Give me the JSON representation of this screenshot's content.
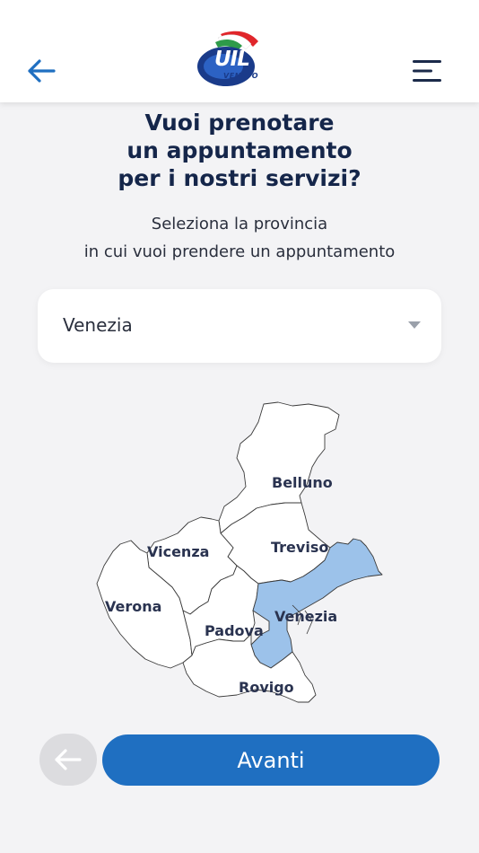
{
  "header": {
    "logo_title": "UIL",
    "logo_subtitle": "VENETO"
  },
  "page": {
    "title_lines": [
      "Vuoi prenotare",
      "un appuntamento",
      "per i nostri servizi?"
    ],
    "subtitle_lines": [
      "Seleziona la provincia",
      "in cui vuoi prendere un appuntamento"
    ]
  },
  "province_select": {
    "selected_value": "Venezia"
  },
  "map": {
    "provinces": [
      {
        "name": "Belluno",
        "selected": false
      },
      {
        "name": "Vicenza",
        "selected": false
      },
      {
        "name": "Treviso",
        "selected": false
      },
      {
        "name": "Verona",
        "selected": false
      },
      {
        "name": "Venezia",
        "selected": true
      },
      {
        "name": "Padova",
        "selected": false
      },
      {
        "name": "Rovigo",
        "selected": false
      }
    ],
    "colors": {
      "selected_fill": "#9cc2ea",
      "default_fill": "#ffffff",
      "border": "#3a3a3a"
    }
  },
  "footer": {
    "next_label": "Avanti"
  },
  "colors": {
    "primary": "#1f6fc1",
    "title": "#15264a",
    "background": "#f3f3f5"
  },
  "icons": {
    "back": "arrow-left-icon",
    "menu": "hamburger-icon",
    "dropdown": "caret-down-icon"
  }
}
